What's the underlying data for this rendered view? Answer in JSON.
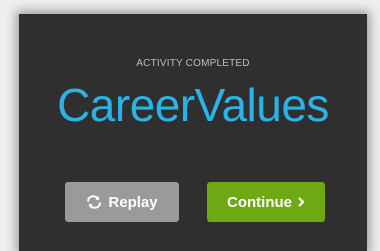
{
  "activity": {
    "status_label": "ACTIVITY COMPLETED",
    "title": "CareerValues"
  },
  "buttons": {
    "replay": {
      "label": "Replay",
      "icon": "replay-icon",
      "color": "#9a9a9a"
    },
    "continue": {
      "label": "Continue",
      "icon": "chevron-right-icon",
      "color": "#6ea913"
    }
  },
  "colors": {
    "card_background": "#2f2f2f",
    "title": "#2ab3e6",
    "status_label": "#bdbdbd"
  }
}
